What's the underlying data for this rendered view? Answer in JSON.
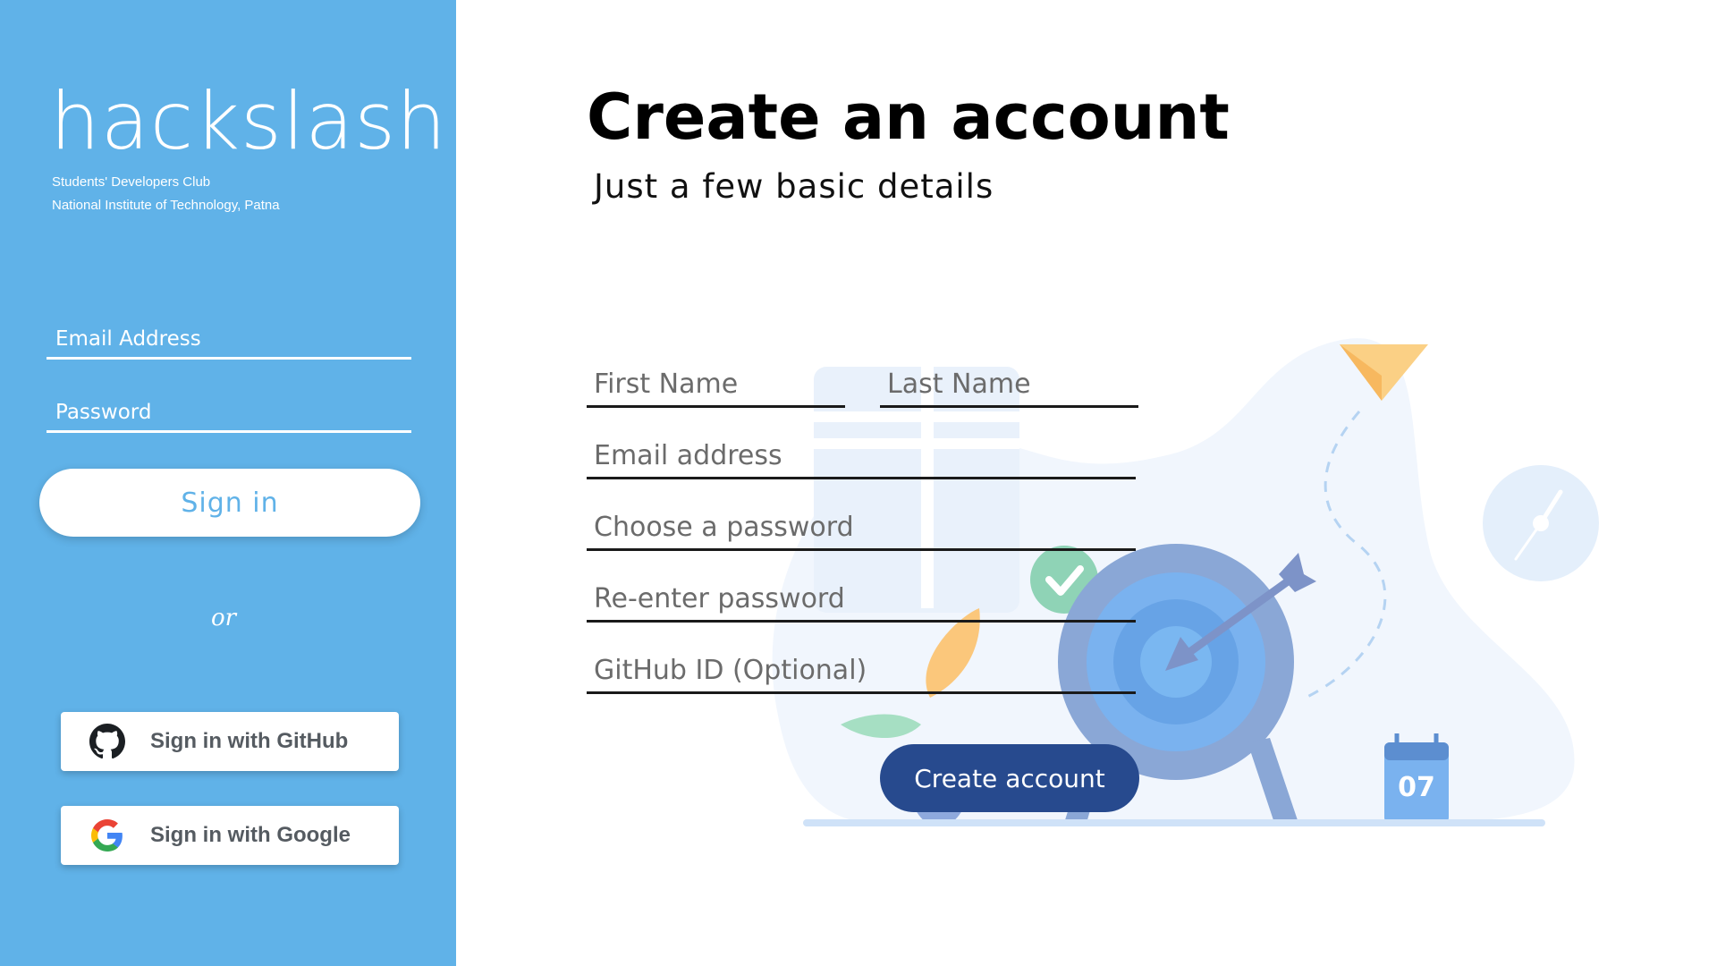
{
  "colors": {
    "sidebar_bg": "#60b2e8",
    "primary_button": "#274a8e",
    "sign_in_text": "#60b2e8"
  },
  "sidebar": {
    "brand": "hackslash",
    "subtitle_line1": "Students' Developers Club",
    "subtitle_line2": "National Institute of Technology, Patna",
    "email_placeholder": "Email Address",
    "password_placeholder": "Password",
    "sign_in_label": "Sign in",
    "or_text": "or",
    "github_label": "Sign in with GitHub",
    "google_label": "Sign in with Google",
    "github_icon": "github-icon",
    "google_icon": "google-icon"
  },
  "main": {
    "title": "Create an account",
    "subtitle": "Just a few basic details",
    "first_name_placeholder": "First Name",
    "last_name_placeholder": "Last Name",
    "email_placeholder": "Email address",
    "password_placeholder": "Choose a password",
    "reenter_password_placeholder": "Re-enter password",
    "github_id_placeholder": "GitHub ID (Optional)",
    "create_account_label": "Create account",
    "illustration": {
      "calendar_day": "07"
    }
  }
}
